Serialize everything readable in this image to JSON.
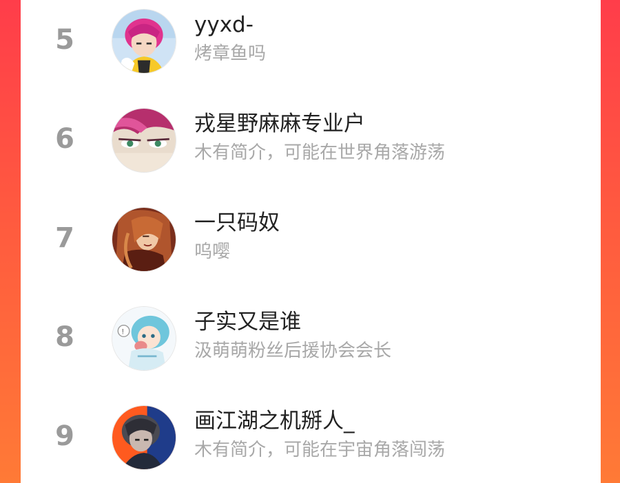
{
  "colors": {
    "background_gradient_top": "#ff3d4a",
    "background_gradient_bottom": "#ff7a36",
    "rank": "#9a9a9a",
    "name": "#222222",
    "bio": "#a8a8a8"
  },
  "ranking": [
    {
      "rank": "5",
      "name": "yyxd-",
      "bio": "烤章鱼吗",
      "avatar_icon": "pink-hair-character-avatar"
    },
    {
      "rank": "6",
      "name": "戎星野麻麻专业户",
      "bio": "木有简介，可能在世界角落游荡",
      "avatar_icon": "red-hair-eyes-avatar"
    },
    {
      "rank": "7",
      "name": "一只码奴",
      "bio": "呜嘤",
      "avatar_icon": "long-hair-character-avatar"
    },
    {
      "rank": "8",
      "name": "子实又是谁",
      "bio": "汲萌萌粉丝后援协会会长",
      "avatar_icon": "blue-hair-chibi-avatar"
    },
    {
      "rank": "9",
      "name": "画江湖之机掰人_",
      "bio": "木有简介，可能在宇宙角落闯荡",
      "avatar_icon": "dark-hair-character-avatar"
    }
  ]
}
